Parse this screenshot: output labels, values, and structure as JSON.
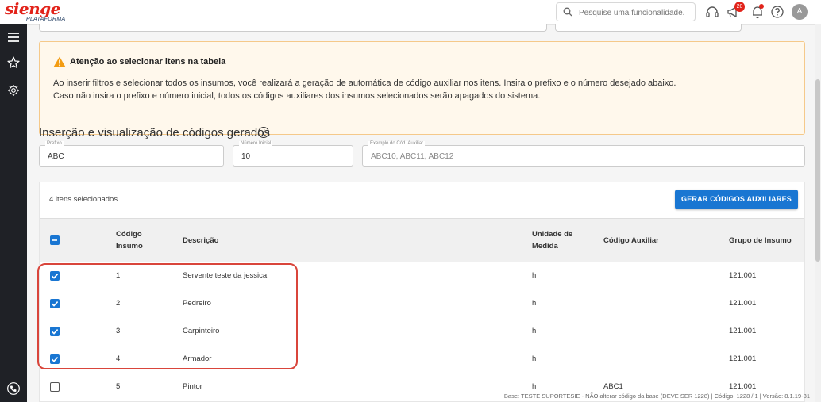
{
  "brand": {
    "logo": "sienge",
    "sub": "PLATAFORMA"
  },
  "topbar": {
    "search_placeholder": "Pesquise uma funcionalidade.",
    "notification_count": "20",
    "avatar_initial": "A"
  },
  "icons": [
    "menu-icon",
    "star-icon",
    "settings-icon",
    "phone-icon",
    "search-icon",
    "headset-icon",
    "megaphone-icon",
    "bell-icon",
    "help-icon",
    "warning-icon",
    "info-icon"
  ],
  "colors": {
    "brand_red": "#e2231a",
    "primary": "#1976d2",
    "sidebar": "#1f2126",
    "warning_bg": "#fff8ec",
    "warning_border": "#f5c98a",
    "highlight": "#d9453b"
  },
  "warning": {
    "title": "Atenção ao selecionar itens na tabela",
    "line1": "Ao inserir filtros e selecionar todos os insumos, você realizará a geração de automática de código auxiliar nos itens. Insira o prefixo e o número desejado abaixo.",
    "line2": "Caso não insira o prefixo e número inicial, todos os códigos auxiliares dos insumos selecionados serão apagados do sistema."
  },
  "section": {
    "title": "Inserção e visualização de códigos gerados"
  },
  "fields": {
    "prefix": {
      "label": "Prefixo",
      "value": "ABC"
    },
    "start": {
      "label": "Número Inicial",
      "value": "10"
    },
    "example": {
      "label": "Exemplo do Cód. Auxiliar",
      "value": "ABC10, ABC11, ABC12"
    }
  },
  "table": {
    "selected_text": "4 itens selecionados",
    "generate_button": "GERAR CÓDIGOS AUXILIARES",
    "headers": {
      "code_line1": "Código",
      "code_line2": "Insumo",
      "description": "Descrição",
      "unit_line1": "Unidade de",
      "unit_line2": "Medida",
      "aux_code": "Código Auxiliar",
      "group": "Grupo de Insumo"
    },
    "rows": [
      {
        "checked": true,
        "code": "1",
        "description": "Servente teste da jessica",
        "unit": "h",
        "aux": "",
        "group": "121.001"
      },
      {
        "checked": true,
        "code": "2",
        "description": "Pedreiro",
        "unit": "h",
        "aux": "",
        "group": "121.001"
      },
      {
        "checked": true,
        "code": "3",
        "description": "Carpinteiro",
        "unit": "h",
        "aux": "",
        "group": "121.001"
      },
      {
        "checked": true,
        "code": "4",
        "description": "Armador",
        "unit": "h",
        "aux": "",
        "group": "121.001"
      },
      {
        "checked": false,
        "code": "5",
        "description": "Pintor",
        "unit": "h",
        "aux": "ABC1",
        "group": "121.001"
      }
    ]
  },
  "footer": {
    "text": "Base: TESTE SUPORTESIE - NÃO alterar código da base (DEVE SER 1228) | Código: 1228 / 1 | Versão: 8.1.19-81"
  }
}
